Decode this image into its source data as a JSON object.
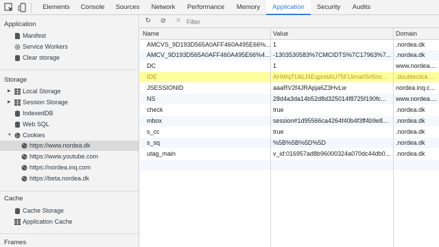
{
  "tabs": [
    {
      "label": "Elements"
    },
    {
      "label": "Console"
    },
    {
      "label": "Sources"
    },
    {
      "label": "Network"
    },
    {
      "label": "Performance"
    },
    {
      "label": "Memory"
    },
    {
      "label": "Application"
    },
    {
      "label": "Security"
    },
    {
      "label": "Audits"
    }
  ],
  "active_tab": "Application",
  "sidebar": {
    "application": {
      "title": "Application",
      "items": [
        {
          "label": "Manifest",
          "icon": "document-icon"
        },
        {
          "label": "Service Workers",
          "icon": "gear-icon"
        },
        {
          "label": "Clear storage",
          "icon": "database-icon"
        }
      ]
    },
    "storage": {
      "title": "Storage",
      "items": [
        {
          "label": "Local Storage",
          "icon": "grid-icon"
        },
        {
          "label": "Session Storage",
          "icon": "grid-icon"
        },
        {
          "label": "IndexedDB",
          "icon": "database-icon"
        },
        {
          "label": "Web SQL",
          "icon": "database-icon"
        },
        {
          "label": "Cookies",
          "icon": "cookie-icon"
        }
      ],
      "cookies": [
        {
          "label": "https://www.nordea.dk"
        },
        {
          "label": "https://www.youtube.com"
        },
        {
          "label": "https://nordea.inq.com"
        },
        {
          "label": "https://beta.nordea.dk"
        }
      ]
    },
    "cache": {
      "title": "Cache",
      "items": [
        {
          "label": "Cache Storage",
          "icon": "database-icon"
        },
        {
          "label": "Application Cache",
          "icon": "grid-icon"
        }
      ]
    },
    "frames": {
      "title": "Frames"
    }
  },
  "toolbar": {
    "filter_placeholder": "Filter"
  },
  "table": {
    "headers": {
      "name": "Name",
      "value": "Value",
      "domain": "Domain"
    },
    "rows": [
      {
        "name": "AMCVS_9D193D565A0AFF460A495E66%...",
        "value": "1",
        "domain": ".nordea.dk"
      },
      {
        "name": "AMCV_9D193D565A0AFF460A495E66%4...",
        "value": "-1303530583%7CMCIDTS%7C17963%7...",
        "domain": ".nordea.dk"
      },
      {
        "name": "DC",
        "value": "1",
        "domain": "www.nordea...."
      },
      {
        "name": "IDE",
        "value": "AHWqTUkLf4EqpndAU75FUima05rl5nc...",
        "domain": ".doubleclick...."
      },
      {
        "name": "JSESSIONID",
        "value": "aaaRV2f4JRApja6Z3HvLw",
        "domain": "nordea.inq.c..."
      },
      {
        "name": "NS",
        "value": "28d4a3da14b52d8d325014f8725f190fc...",
        "domain": "www.nordea...."
      },
      {
        "name": "check",
        "value": "true",
        "domain": ".nordea.dk"
      },
      {
        "name": "mbox",
        "value": "session#1d95566ca4264f40b4f3ff4b9e8...",
        "domain": ".nordea.dk"
      },
      {
        "name": "s_cc",
        "value": "true",
        "domain": ".nordea.dk"
      },
      {
        "name": "s_sq",
        "value": "%5B%5B%5D%5D",
        "domain": ".nordea.dk"
      },
      {
        "name": "utag_main",
        "value": "v_id:016957ad8b96000324a070dc44db0...",
        "domain": ".nordea.dk"
      }
    ]
  },
  "colors": {
    "accent": "#3879d9",
    "highlight_row": "#ffff9e",
    "highlight_text": "#b89a10"
  }
}
